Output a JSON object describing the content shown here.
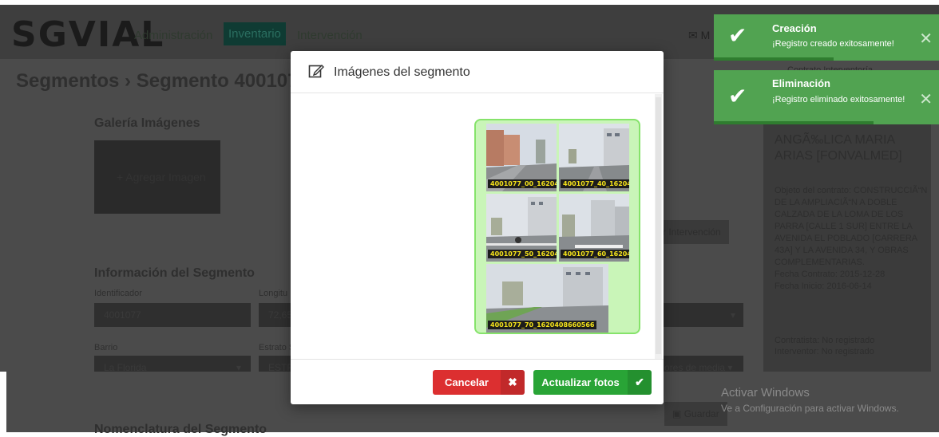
{
  "app": {
    "logo": "SGVIAL",
    "nav": [
      "Administración",
      "Inventario",
      "Intervención"
    ],
    "mail_label": "M",
    "breadcrumb": {
      "parent": "Segmentos",
      "current": "Segmento 4001077"
    },
    "gallery_title": "Galería Imágenes",
    "add_image": "+ Agregar Imagen",
    "intervention_button": "r Intervención",
    "segment_info_title": "Información del Segmento",
    "fields": {
      "identificador_label": "Identificador",
      "identificador_value": "4001077",
      "longitud_label": "Longitu",
      "longitud_value": "72,65",
      "barrio_label": "Barrio",
      "barrio_value": "La Florida",
      "estrato_label": "Estrato S",
      "estrato_value": "ESTR",
      "media_value": "ores de media"
    },
    "guardar_label": "Guardar",
    "nomenclatura_title": "Nomenclatura del Segmento",
    "contract_card": {
      "header": "Contrato Interventoría",
      "name": "ANGÃ‰LICA MARIA ARIAS [FONVALMED]",
      "objeto": "Objeto del contrato: CONSTRUCCIÃ“N DE LA AMPLIACIÃ“N A DOBLE CALZADA DE LA LOMA DE LOS PARRA [CALLE 1 SUR] ENTRE LA AVENIDA EL POBLADO [CARRERA 43A] Y LA AVENIDA 34, Y OBRAS COMPLEMENTARIAS.",
      "fecha_contrato": "Fecha Contrato: 2015-12-28",
      "fecha_inicio": "Fecha Inicio: 2016-06-14",
      "contratista": "Contratista: No registrado",
      "interventor": "Interventor: No registrado"
    }
  },
  "modal": {
    "title": "Imágenes del segmento",
    "images": [
      {
        "caption": "4001077_00_162040"
      },
      {
        "caption": "4001077_40_162040"
      },
      {
        "caption": "4001077_50_162040"
      },
      {
        "caption": "4001077_60_162040"
      },
      {
        "caption": "4001077_70_1620408660566"
      }
    ],
    "cancel_label": "Cancelar",
    "update_label": "Actualizar fotos",
    "cancel_icon": "x-icon",
    "update_icon": "check-icon"
  },
  "toasts": [
    {
      "title": "Creación",
      "message": "¡Registro creado exitosamente!"
    },
    {
      "title": "Eliminación",
      "message": "¡Registro eliminado exitosamente!"
    }
  ],
  "watermark": {
    "line1": "Activar Windows",
    "line2": "Ve a Configuración para activar Windows."
  },
  "colors": {
    "cancel": "#dc2f30",
    "update": "#29a436",
    "toast": "#51a351",
    "gallery_border": "#86e36b"
  }
}
